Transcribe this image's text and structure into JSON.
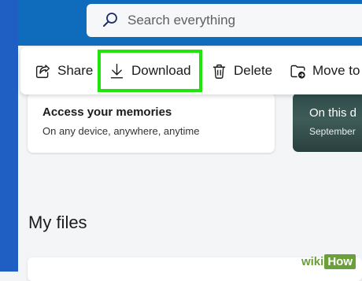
{
  "search": {
    "placeholder": "Search everything"
  },
  "toolbar": {
    "share_label": "Share",
    "download_label": "Download",
    "delete_label": "Delete",
    "move_label": "Move to"
  },
  "memories_card": {
    "title": "Access your memories",
    "subtitle": "On any device, anywhere, anytime"
  },
  "on_this_day_card": {
    "title": "On this d",
    "subtitle": "September"
  },
  "sections": {
    "my_files": "My files"
  },
  "watermark": {
    "part1": "wiki",
    "part2": "How"
  },
  "colors": {
    "header_blue": "#0f6cbd",
    "highlight_green": "#1ee60a",
    "accent": "#1f5fc4"
  }
}
